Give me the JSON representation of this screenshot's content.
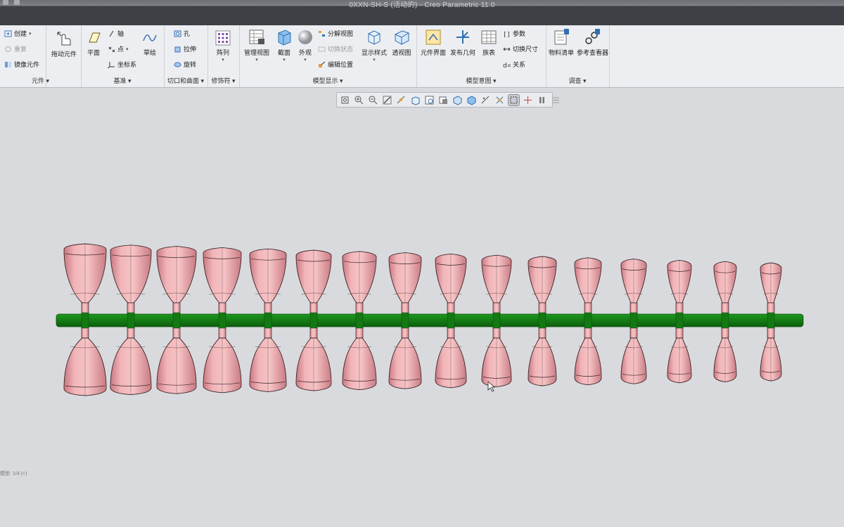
{
  "window": {
    "title": "0XXN-SH-S (活动的) - Creo Parametric 11.0"
  },
  "ribbon": {
    "groups": {
      "component": {
        "label": "元件 ▾",
        "items": {
          "create": "创建",
          "repeat": "重复",
          "mirror": "镜像元件",
          "drag": "拖动元件"
        }
      },
      "datum": {
        "label": "基准 ▾",
        "items": {
          "plane": "平面",
          "axis": "轴",
          "point": "点",
          "coord": "坐标系",
          "sketch": "草绘"
        }
      },
      "cut": {
        "label": "切口和曲面 ▾",
        "items": {
          "hole": "孔",
          "extrude": "拉伸",
          "revolve": "旋转"
        }
      },
      "modifiers": {
        "label": "修饰符 ▾",
        "items": {
          "pattern": "阵列"
        }
      },
      "model_display": {
        "label": "模型显示 ▾",
        "items": {
          "manage_views": "管理视图",
          "section": "截面",
          "appearance": "外观",
          "explode": "分解视图",
          "toggle_status": "切换状态",
          "edit_position": "编辑位置",
          "display_style": "显示样式",
          "perspective": "透视图"
        }
      },
      "model_intent": {
        "label": "模型意图 ▾",
        "items": {
          "component_interface": "元件界面",
          "publish_geometry": "发布几何",
          "family_table": "族表",
          "parameters": "参数",
          "switch_dims": "切换尺寸",
          "relations": "关系"
        }
      },
      "investigate": {
        "label": "调查 ▾",
        "items": {
          "bom": "物料清单",
          "ref_viewer": "参考查看器"
        }
      }
    }
  },
  "status": {
    "text": "模型: 1/4 (+)"
  },
  "colors": {
    "nail": "#e8a3a8",
    "nail_edge": "#3b2427",
    "runner": "#137a13"
  },
  "model": {
    "name": "nail tip set on runner",
    "nail_count_per_row": 16,
    "rows": [
      "upper",
      "lower"
    ]
  }
}
